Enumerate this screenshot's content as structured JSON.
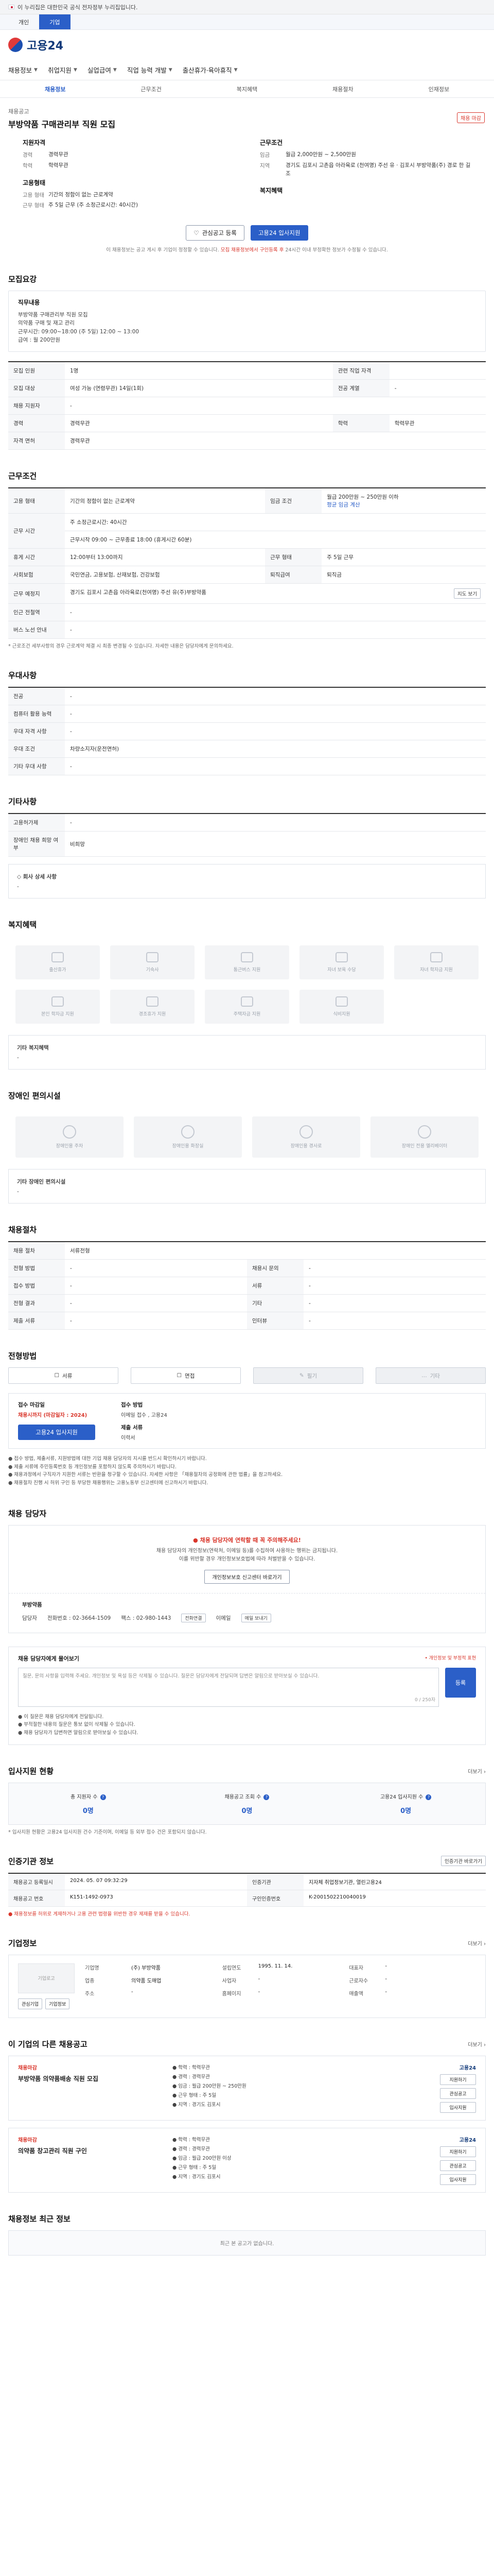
{
  "gov_bar": {
    "text": "이 누리집은 대한민국 공식 전자정부 누리집입니다."
  },
  "sub_tabs": [
    {
      "label": "개인",
      "active": false
    },
    {
      "label": "기업",
      "active": true
    }
  ],
  "header": {
    "logo": "고용24"
  },
  "gnb": [
    "채용정보",
    "취업지원",
    "실업급여",
    "직업 능력 개발",
    "출산휴가·육아휴직"
  ],
  "lnb": [
    "채용정보",
    "근무조건",
    "복지혜택",
    "채용절차",
    "인재정보"
  ],
  "job": {
    "company_small": "채용공고",
    "title": "부방약품 구매관리부 직원 모집",
    "badge": "채용 마감",
    "summary_left": [
      {
        "head": "지원자격",
        "rows": [
          {
            "k": "경력",
            "v": "경력무관"
          },
          {
            "k": "학력",
            "v": "학력무관"
          }
        ]
      },
      {
        "head": "고용형태",
        "rows": [
          {
            "k": "고용 형태",
            "v": "기간의 정함이 없는 근로계약"
          },
          {
            "k": "근무 형태",
            "v": "주 5일 근무 (주 소정근로시간: 40시간)"
          }
        ]
      }
    ],
    "summary_right": [
      {
        "head": "근무조건",
        "rows": [
          {
            "k": "임금",
            "v": "월급 2,000만원 ~ 2,500만원"
          },
          {
            "k": "지역",
            "v": "경기도 김포시 고촌읍 아라육로 (천여명) 주선 유 · 김포시 부방약품(주) 경로 한 길조"
          }
        ]
      },
      {
        "head": "복지혜택",
        "rows": []
      }
    ],
    "btn_interest": "관심공고 등록",
    "btn_apply": "고용24 입사지원",
    "notice_pre": "이 채용정보는 공고 게시 후 기업이 정정할 수 있습니다.",
    "notice_red": "모집 채용정보에서 구인등록 후 ",
    "notice_post": "24시간 이내 부정확한 정보가 수정될 수 있습니다."
  },
  "recruit_section": {
    "title": "모집요강",
    "panel_head": "직무내용",
    "panel_lines": [
      "부방약품 구매관리부 직원 모집",
      "의약품 구매 및 재고 관리",
      "근무시간: 09:00~18:00 (주 5일) 12:00 ~ 13:00",
      "급여 : 월 200만원"
    ],
    "rows": [
      {
        "k": "모집 인원",
        "v": "1명",
        "k2": "관련 직업 자격",
        "v2": ""
      },
      {
        "k": "모집 대상",
        "v": "여성 가능 (연령무관) 14일(1회)",
        "k2": "전공 계열",
        "v2": "-"
      },
      {
        "k": "채용 지원자",
        "v": "-",
        "k2": "",
        "v2": ""
      },
      {
        "k": "경력",
        "v": "경력무관",
        "k2": "학력",
        "v2": "학력무관"
      },
      {
        "k": "자격 면허",
        "v": "경력무관",
        "k2": "",
        "v2": ""
      }
    ]
  },
  "work_section": {
    "title": "근무조건",
    "rows": [
      {
        "k": "고용 형태",
        "v": "기간의 정함이 없는 근로계약",
        "k2": "임금 조건",
        "v2": "월급 200만원 ~ 250만원 이하",
        "v2link": "평균 임금 계산"
      },
      {
        "k": "근무 시간",
        "v": "주 소정근로시간: 40시간",
        "k2": "",
        "v2": ""
      },
      {
        "k": "",
        "v": "근무시작 09:00 ~ 근무종료 18:00 (휴게시간 60분)",
        "k2": "",
        "v2": ""
      },
      {
        "k": "휴게 시간",
        "v": "12:00부터 13:00까지",
        "k2": "근무 형태",
        "v2": "주 5일 근무"
      },
      {
        "k": "사회보험",
        "v": "국민연금, 고용보험, 산재보험, 건강보험",
        "k2": "퇴직급여",
        "v2": "퇴직금"
      },
      {
        "k": "근무 예정지",
        "v": "경기도 김포시 고촌읍 아라육로(천여명) 주선 유(주)부방약품",
        "k2": "",
        "v2": "",
        "btn": "지도 보기"
      },
      {
        "k": "인근 전철역",
        "v": "-",
        "k2": "",
        "v2": ""
      },
      {
        "k": "버스 노선 안내",
        "v": "-",
        "k2": "",
        "v2": ""
      }
    ],
    "note": "* 근로조건 세부사항의 경우 근로계약 체결 시 최종 변경될 수 있습니다. 자세한 내용은 담당자에게 문의하세요."
  },
  "prefer_section": {
    "title": "우대사항",
    "rows": [
      {
        "k": "전공",
        "v": "-"
      },
      {
        "k": "컴퓨터 활용 능력",
        "v": "-"
      },
      {
        "k": "우대 자격 사항",
        "v": "-"
      },
      {
        "k": "우대 조건",
        "v": "차량소지자(운전면허)"
      },
      {
        "k": "기타 우대 사항",
        "v": "-"
      }
    ]
  },
  "etc_section": {
    "title": "기타사항",
    "rows": [
      {
        "k": "고용허가제",
        "v": "-"
      },
      {
        "k": "장애인 채용 희망 여부",
        "v": "비희망"
      }
    ],
    "box_head": "◇ 회사 상세 사항",
    "box_text": "-"
  },
  "welfare_section": {
    "title": "복지혜택",
    "items": [
      "출산휴가",
      "기숙사",
      "통근버스 지원",
      "자녀 보육 수당",
      "자녀 학자금 지원",
      "본인 학자금 지원",
      "경조휴가 지원",
      "주택자금 지원",
      "식비지원",
      ""
    ],
    "box_head": "기타 복지혜택",
    "box_text": "-"
  },
  "disabled_section": {
    "title": "장애인 편의시설",
    "items": [
      "장애인용 주차",
      "장애인용 화장실",
      "장애인용 경사로",
      "장애인 전용 엘리베이터"
    ],
    "box_head": "기타 장애인 편의시설",
    "box_text": "-"
  },
  "process_section": {
    "title": "채용절차",
    "rows": [
      {
        "k": "채용 절차",
        "v": "서류전형"
      },
      {
        "k": "전형 방법",
        "v": "-",
        "k2": "채용시 문의",
        "v2": "-"
      },
      {
        "k": "접수 방법",
        "v": "-",
        "k2": "서류",
        "v2": "-"
      },
      {
        "k": "전형 결과",
        "v": "-",
        "k2": "기타",
        "v2": "-"
      },
      {
        "k": "제출 서류",
        "v": "-",
        "k2": "인터뷰",
        "v2": "-"
      }
    ]
  },
  "apply_section": {
    "title": "전형방법",
    "methods": [
      {
        "label": "서류",
        "off": false
      },
      {
        "label": "면접",
        "off": false
      },
      {
        "label": "필기",
        "off": true
      },
      {
        "label": "기타",
        "off": true
      }
    ],
    "period_k": "접수 마감일",
    "period_v": "채용시까지 (마감일자 : 2024)",
    "period_k2": "접수 방법",
    "period_v2": "이메일 접수 , 고용24",
    "period_k3": "제출 서류",
    "period_v3": "이력서",
    "apply_btn": "고용24 입사지원",
    "bullets": [
      "● 접수 방법, 제출서류, 지원방법에 대한 기업 채용 담당자의 지시를 반드시 확인하시기 바랍니다.",
      "● 제출 서류에 주민등록번호 등 개인정보를 포함하지 않도록 주의하시기 바랍니다.",
      "● 채용과정에서 구직자가 지원한 서류는 반환을 청구할 수 있습니다. 자세한 사항은 「채용절차의 공정화에 관한 법률」을 참고하세요.",
      "● 채용절차 진행 시 허위 구인 등 부당한 채용행위는 고용노동부 신고센터에 신고하시기 바랍니다."
    ]
  },
  "contact_section": {
    "title": "채용 담당자",
    "warn": "● 채용 담당자에 연락할 때 꼭 주의해주세요!",
    "desc1": "채용 담당자의 개인정보(연락처, 이메일 등)를 수집하여 사용하는 행위는 금지됩니다.",
    "desc2": "이를 위반할 경우 개인정보보호법에 따라 처벌받을 수 있습니다.",
    "center_btn": "개인정보보호 신고센터 바로가기",
    "strip_head": "부방약품",
    "name_k": "담당자",
    "phone": "전화번호 : 02-3664-1509",
    "fax": "팩스 : 02-980-1443",
    "call_btn": "전화연결",
    "email_k": "이메일",
    "email_btn": "메일 보내기"
  },
  "ask_section": {
    "title": "채용 담당자에게 물어보기",
    "req": "• 개인정보 및 부정적 표현",
    "placeholder": "질문, 문의 사항을 입력해 주세요. 개인정보 및 욕설 등은 삭제될 수 있습니다. 질문은 담당자에게 전달되며 답변은 알림으로 받아보실 수 있습니다.",
    "count": "0 / 250자",
    "btn": "등록",
    "bullets": [
      "● 이 질문은 채용 담당자에게 전달됩니다.",
      "● 부적절한 내용의 질문은 통보 없이 삭제될 수 있습니다.",
      "● 채용 담당자가 답변하면 알림으로 받아보실 수 있습니다."
    ]
  },
  "stat_section": {
    "title": "입사지원 현황",
    "more": "더보기",
    "stats": [
      {
        "k": "총 지원자 수",
        "v": "0명"
      },
      {
        "k": "채용공고 조회 수",
        "v": "0명"
      },
      {
        "k": "고용24 입사지원 수",
        "v": "0명"
      }
    ],
    "note": "* 입사지원 현황은 고용24 입사지원 건수 기준이며, 이메일 등 외부 접수 건은 포함되지 않습니다."
  },
  "meta_section": {
    "title": "인증기관 정보",
    "link": "인증기관 바로가기",
    "rows": [
      {
        "k": "채용공고 등록일시",
        "v": "2024. 05. 07 09:32:29",
        "k2": "인증기관",
        "v2": "지자체 취업정보기관, 열린고용24"
      },
      {
        "k": "채용공고 번호",
        "v": "K151-1492-0973",
        "k2": "구인인증번호",
        "v2": "K-2001502210040019"
      }
    ],
    "note": "● 채용정보를 허위로 게재하거나 고용 관련 법령을 위반한 경우 제재를 받을 수 있습니다."
  },
  "company_section": {
    "title": "기업정보",
    "more": "더보기",
    "logo": "기업로고",
    "btn1": "관심기업",
    "btn2": "기업정보",
    "fields": [
      {
        "k": "기업명",
        "v": "(주) 부방약품"
      },
      {
        "k": "설립연도",
        "v": "1995. 11. 14."
      },
      {
        "k": "대표자",
        "v": "-"
      },
      {
        "k": "업종",
        "v": "의약품 도매업"
      },
      {
        "k": "사업자",
        "v": "-"
      },
      {
        "k": "근로자수",
        "v": "-"
      },
      {
        "k": "주소",
        "v": "-"
      },
      {
        "k": "홈페이지",
        "v": "-"
      },
      {
        "k": "매출액",
        "v": "-"
      }
    ]
  },
  "other_jobs": {
    "title": "이 기업의 다른 채용공고",
    "more": "더보기",
    "cards": [
      {
        "label": "채용마감",
        "title": "부방약품 의약품배송 직원 모집",
        "lines": [
          "● 학력 : 학력무관",
          "● 경력 : 경력무관",
          "● 임금 : 월급 200만원 ~ 250만원",
          "● 근무 형태 : 주 5일",
          "● 지역 : 경기도 김포시"
        ],
        "brand": "고용24",
        "btns": [
          "지원하기",
          "관심공고",
          "입사지원"
        ]
      },
      {
        "label": "채용마감",
        "title": "의약품 창고관리 직원 구인",
        "lines": [
          "● 학력 : 학력무관",
          "● 경력 : 경력무관",
          "● 임금 : 월급 200만원 이상",
          "● 근무 형태 : 주 5일",
          "● 지역 : 경기도 김포시"
        ],
        "brand": "고용24",
        "btns": [
          "지원하기",
          "관심공고",
          "입사지원"
        ]
      }
    ]
  },
  "recent_section": {
    "title": "채용정보 최근 정보",
    "text": "최근 본 공고가 없습니다."
  }
}
